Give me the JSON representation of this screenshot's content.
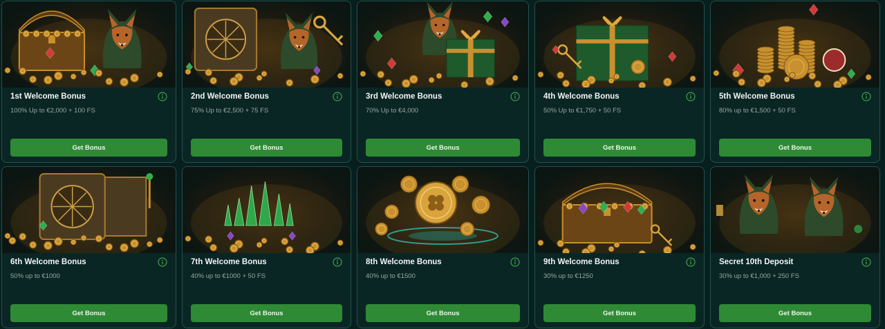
{
  "bonuses": [
    {
      "title": "1st Welcome Bonus",
      "subtitle": "100% Up to €2,000 + 100 FS",
      "button": "Get Bonus",
      "art": "fox-treasure-chest"
    },
    {
      "title": "2nd Welcome Bonus",
      "subtitle": "75% Up to €2,500 + 75 FS",
      "button": "Get Bonus",
      "art": "fox-vault-key"
    },
    {
      "title": "3rd Welcome Bonus",
      "subtitle": "70% Up to €4,000",
      "button": "Get Bonus",
      "art": "fox-gift-box"
    },
    {
      "title": "4th Welcome Bonus",
      "subtitle": "50% Up to €1,750 + 50 FS",
      "button": "Get Bonus",
      "art": "gift-box-key"
    },
    {
      "title": "5th Welcome Bonus",
      "subtitle": "80% up to €1,500 + 50 FS",
      "button": "Get Bonus",
      "art": "coin-stacks-gems"
    },
    {
      "title": "6th Welcome Bonus",
      "subtitle": "50% up to €1000",
      "button": "Get Bonus",
      "art": "open-vault-coins"
    },
    {
      "title": "7th Welcome Bonus",
      "subtitle": "40% up to €1000 + 50 FS",
      "button": "Get Bonus",
      "art": "emerald-crystals"
    },
    {
      "title": "8th Welcome Bonus",
      "subtitle": "40% up to €1500",
      "button": "Get Bonus",
      "art": "clover-coins-portal"
    },
    {
      "title": "9th Welcome Bonus",
      "subtitle": "30% up to €1250",
      "button": "Get Bonus",
      "art": "open-treasure-chest"
    },
    {
      "title": "Secret 10th Deposit",
      "subtitle": "30% up to €1,000 + 250 FS",
      "button": "Get Bonus",
      "art": "two-foxes"
    }
  ],
  "colors": {
    "background": "#07201f",
    "card": "#0a2624",
    "card_border": "#24514a",
    "button": "#2f8a35",
    "gold": "#c8902e",
    "emerald": "#2fae4f",
    "fox": "#b5652a",
    "hood": "#2d4a2a"
  }
}
